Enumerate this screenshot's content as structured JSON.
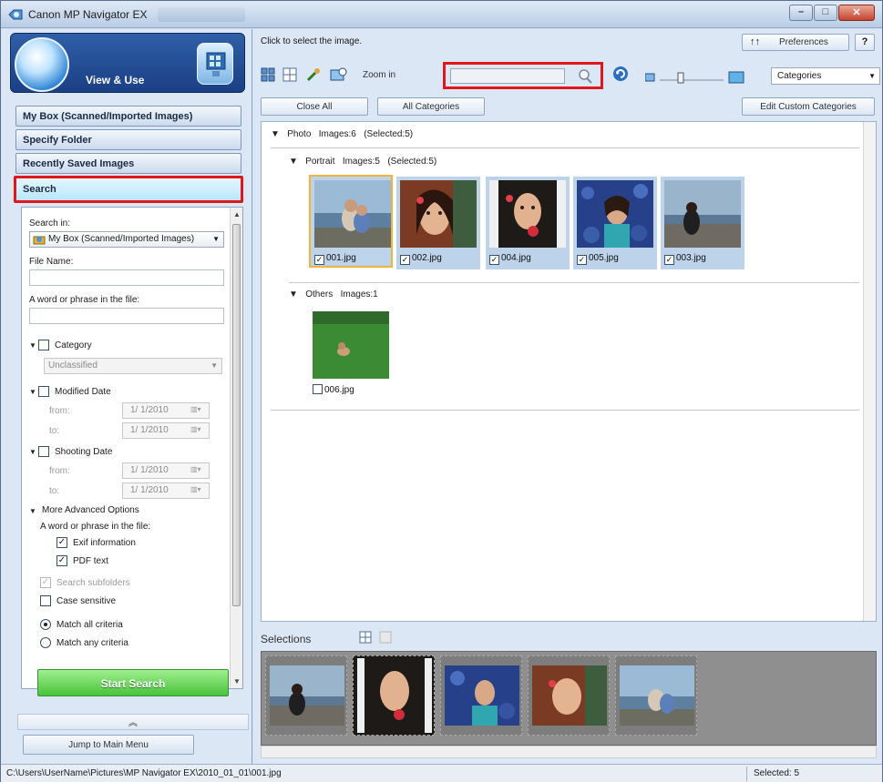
{
  "window": {
    "title": "Canon MP Navigator EX"
  },
  "mode": {
    "title": "View & Use"
  },
  "nav": {
    "items": [
      {
        "label": "My Box (Scanned/Imported Images)"
      },
      {
        "label": "Specify Folder"
      },
      {
        "label": "Recently Saved Images"
      },
      {
        "label": "Search",
        "active": true
      }
    ]
  },
  "search_panel": {
    "search_in_label": "Search in:",
    "search_in_value": "My Box (Scanned/Imported Images)",
    "file_name_label": "File Name:",
    "file_name_value": "",
    "phrase_label": "A word or phrase in the file:",
    "phrase_value": "",
    "category_label": "Category",
    "category_checked": false,
    "category_value": "Unclassified",
    "modified_label": "Modified Date",
    "modified_checked": false,
    "from_label": "from:",
    "to_label": "to:",
    "modified_from": "1/  1/2010",
    "modified_to": "1/  1/2010",
    "shooting_label": "Shooting Date",
    "shooting_checked": false,
    "shooting_from": "1/  1/2010",
    "shooting_to": "1/  1/2010",
    "advanced_label": "More Advanced Options",
    "advanced_phrase_label": "A word or phrase in the file:",
    "exif_label": "Exif information",
    "exif_checked": true,
    "pdf_label": "PDF text",
    "pdf_checked": true,
    "subfolders_label": "Search subfolders",
    "subfolders_checked": true,
    "case_label": "Case sensitive",
    "case_checked": false,
    "match_all_label": "Match all criteria",
    "match_any_label": "Match any criteria",
    "match_selected": "all"
  },
  "start_search_label": "Start Search",
  "collapse_label": "»",
  "jump_label": "Jump to Main Menu",
  "right": {
    "hint": "Click to select the image.",
    "preferences_label": "Preferences",
    "help_label": "?",
    "zoom_label": "Zoom in",
    "search_value": "",
    "categories_value": "Categories",
    "close_all_label": "Close All",
    "all_categories_label": "All Categories",
    "edit_custom_label": "Edit Custom Categories"
  },
  "groups": {
    "photo": {
      "name": "Photo",
      "images": "Images:6",
      "selected": "(Selected:5)"
    },
    "portrait": {
      "name": "Portrait",
      "images": "Images:5",
      "selected": "(Selected:5)"
    },
    "others": {
      "name": "Others",
      "images": "Images:1"
    }
  },
  "thumbs": [
    {
      "file": "001.jpg",
      "checked": true
    },
    {
      "file": "002.jpg",
      "checked": true
    },
    {
      "file": "004.jpg",
      "checked": true
    },
    {
      "file": "005.jpg",
      "checked": true
    },
    {
      "file": "003.jpg",
      "checked": true
    }
  ],
  "other_thumbs": [
    {
      "file": "006.jpg",
      "checked": false
    }
  ],
  "selections_label": "Selections",
  "status": {
    "path": "C:\\Users\\UserName\\Pictures\\MP Navigator EX\\2010_01_01\\001.jpg",
    "selected": "Selected: 5"
  },
  "colors": {
    "highlight_red": "#e2171b",
    "start_green": "#48c23a",
    "panel_blue": "#dbe7f5"
  }
}
